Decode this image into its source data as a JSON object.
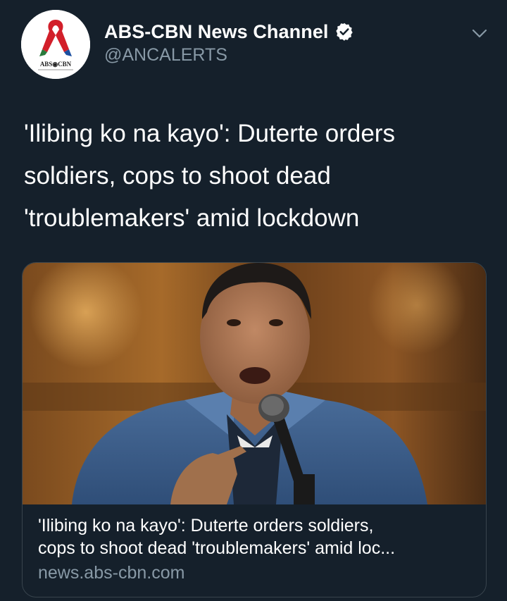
{
  "account": {
    "display_name": "ABS-CBN News Channel",
    "handle": "@ANCALERTS",
    "verified": true,
    "avatar_logo_text": "ABS CBN"
  },
  "tweet": {
    "text": "'Ilibing ko na kayo': Duterte orders\nsoldiers, cops to shoot dead\n'troublemakers' amid lockdown"
  },
  "link_card": {
    "title_line1": "'Ilibing ko na kayo': Duterte orders soldiers,",
    "title_line2": "cops to shoot dead 'troublemakers' amid loc...",
    "domain": "news.abs-cbn.com",
    "image_alt": "Photo of a man in a denim jacket speaking into a microphone"
  },
  "icons": {
    "verified": "verified-badge-icon",
    "menu": "chevron-down-icon"
  },
  "colors": {
    "background": "#15202b",
    "primary_text": "#ffffff",
    "secondary_text": "#8899a6",
    "card_border": "#38444d"
  }
}
